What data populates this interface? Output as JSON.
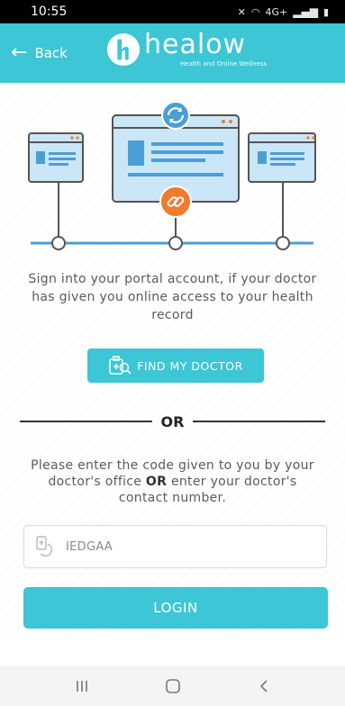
{
  "status_bar": {
    "time": "10:55",
    "network": "4G+"
  },
  "header": {
    "back_label": "Back",
    "logo_name": "healow",
    "logo_tagline": "Health and Online Wellness"
  },
  "intro_text": "Sign into your portal account, if your doctor has given you online access to your health record",
  "find_doctor_label": "FIND MY DOCTOR",
  "or_label": "OR",
  "instructions": {
    "part1": "Please enter the code given to you by your doctor's office ",
    "emphasis": "OR",
    "part2": " enter your doctor's contact number."
  },
  "code_input": {
    "value": "IEDGAA"
  },
  "login_label": "LOGIN",
  "colors": {
    "accent": "#3cc6d6",
    "orange": "#f07b2e",
    "illus_blue": "#4a9fd6"
  },
  "icons": [
    "back-arrow-icon",
    "healow-logo-icon",
    "sync-icon",
    "link-icon",
    "find-doctor-icon",
    "phone-icon",
    "recents-icon",
    "home-icon",
    "nav-back-icon"
  ]
}
